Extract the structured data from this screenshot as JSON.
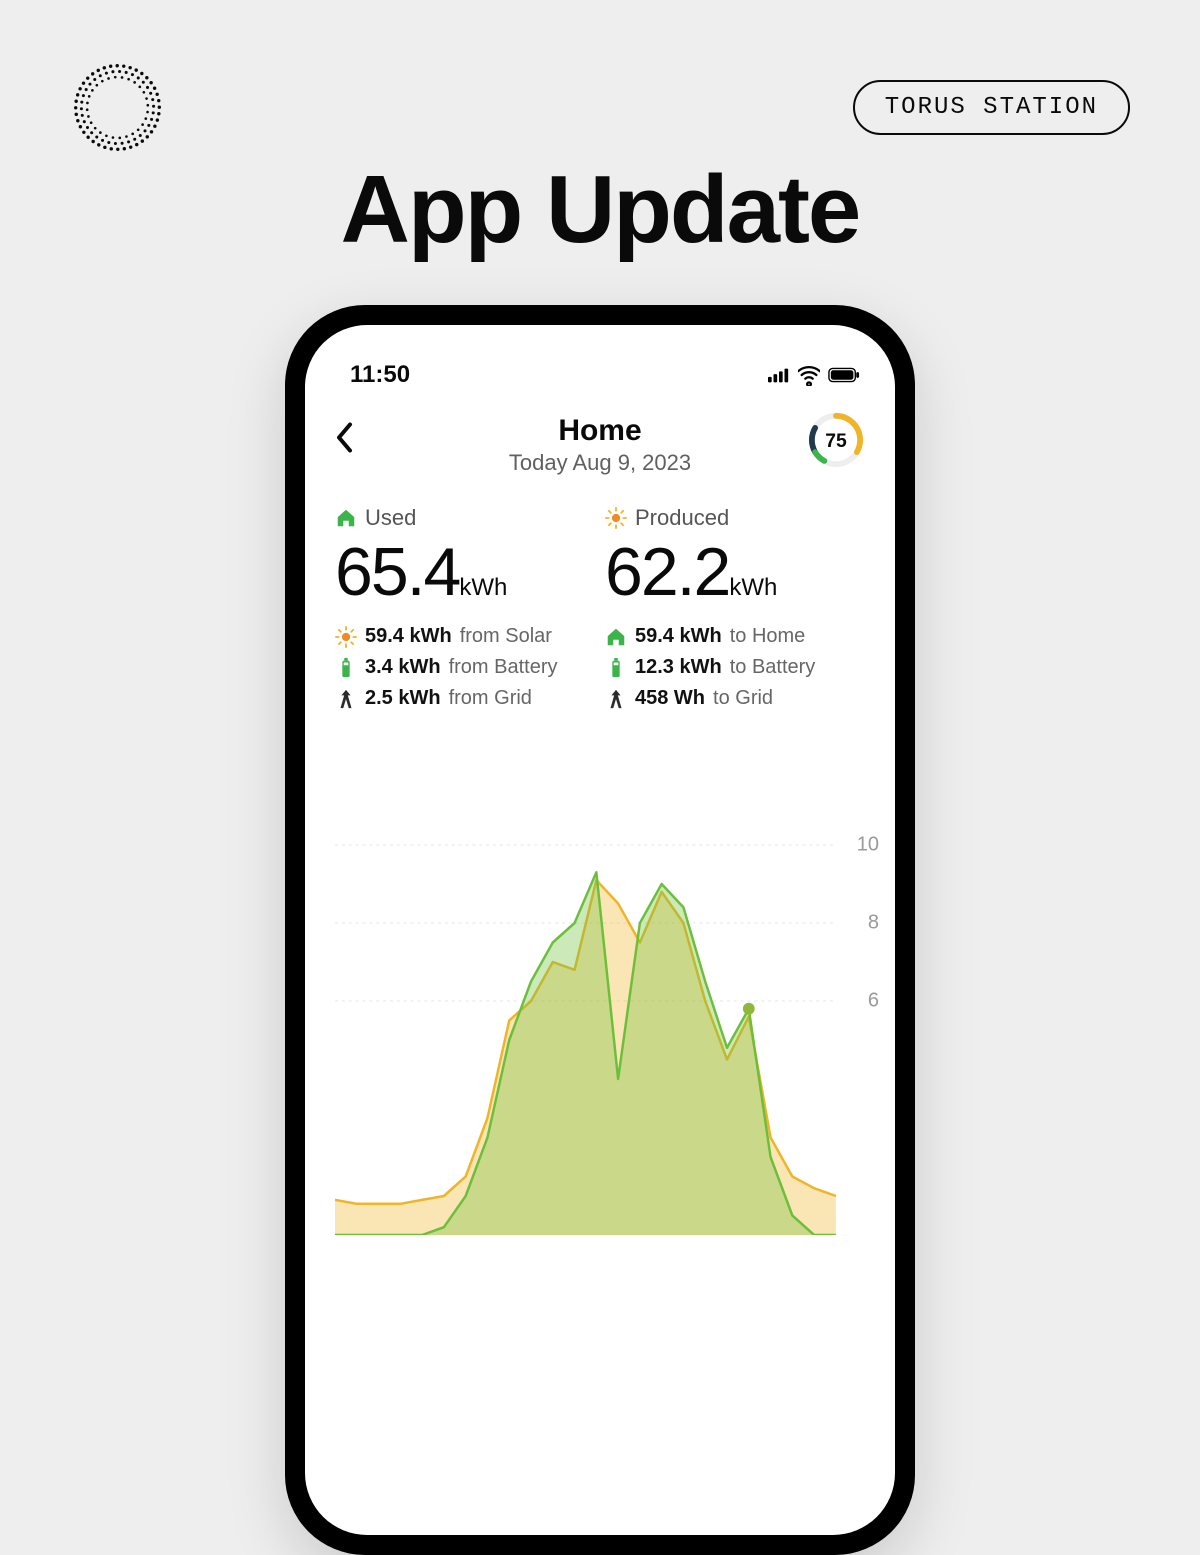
{
  "brand": {
    "pill_text": "TORUS STATION"
  },
  "headline": "App Update",
  "status_bar": {
    "time": "11:50"
  },
  "header": {
    "title": "Home",
    "subtitle": "Today Aug 9, 2023",
    "score": "75"
  },
  "metrics": {
    "used": {
      "label": "Used",
      "value": "65.4",
      "unit": "kWh",
      "breakdown": [
        {
          "icon": "sun",
          "value": "59.4 kWh",
          "dir": "from Solar"
        },
        {
          "icon": "battery",
          "value": "3.4 kWh",
          "dir": "from Battery"
        },
        {
          "icon": "grid",
          "value": "2.5 kWh",
          "dir": "from Grid"
        }
      ]
    },
    "produced": {
      "label": "Produced",
      "value": "62.2",
      "unit": "kWh",
      "breakdown": [
        {
          "icon": "home",
          "value": "59.4 kWh",
          "dir": "to Home"
        },
        {
          "icon": "battery",
          "value": "12.3 kWh",
          "dir": "to Battery"
        },
        {
          "icon": "grid",
          "value": "458 Wh",
          "dir": "to Grid"
        }
      ]
    }
  },
  "chart_data": {
    "type": "area",
    "title": "",
    "xlabel": "",
    "ylabel": "",
    "ylim": [
      0,
      10
    ],
    "y_ticks": [
      6,
      8,
      10
    ],
    "x": [
      0,
      1,
      2,
      3,
      4,
      5,
      6,
      7,
      8,
      9,
      10,
      11,
      12,
      13,
      14,
      15,
      16,
      17,
      18,
      19,
      20,
      21,
      22,
      23
    ],
    "series": [
      {
        "name": "Used",
        "color": "#f0b429",
        "values": [
          0.9,
          0.8,
          0.8,
          0.8,
          0.9,
          1.0,
          1.5,
          3.0,
          5.5,
          6.0,
          7.0,
          6.8,
          9.1,
          8.5,
          7.5,
          8.8,
          8.0,
          6.0,
          4.5,
          5.6,
          2.5,
          1.5,
          1.2,
          1.0
        ]
      },
      {
        "name": "Produced",
        "color": "#6cbf3a",
        "values": [
          0.0,
          0.0,
          0.0,
          0.0,
          0.0,
          0.2,
          1.0,
          2.5,
          5.0,
          6.5,
          7.5,
          8.0,
          9.3,
          4.0,
          8.0,
          9.0,
          8.4,
          6.5,
          4.8,
          5.8,
          2.0,
          0.5,
          0.0,
          0.0
        ]
      }
    ]
  },
  "colors": {
    "orange": "#f08a24",
    "yellow": "#f0b429",
    "green": "#3bb54a",
    "dark": "#1f3a4d"
  }
}
